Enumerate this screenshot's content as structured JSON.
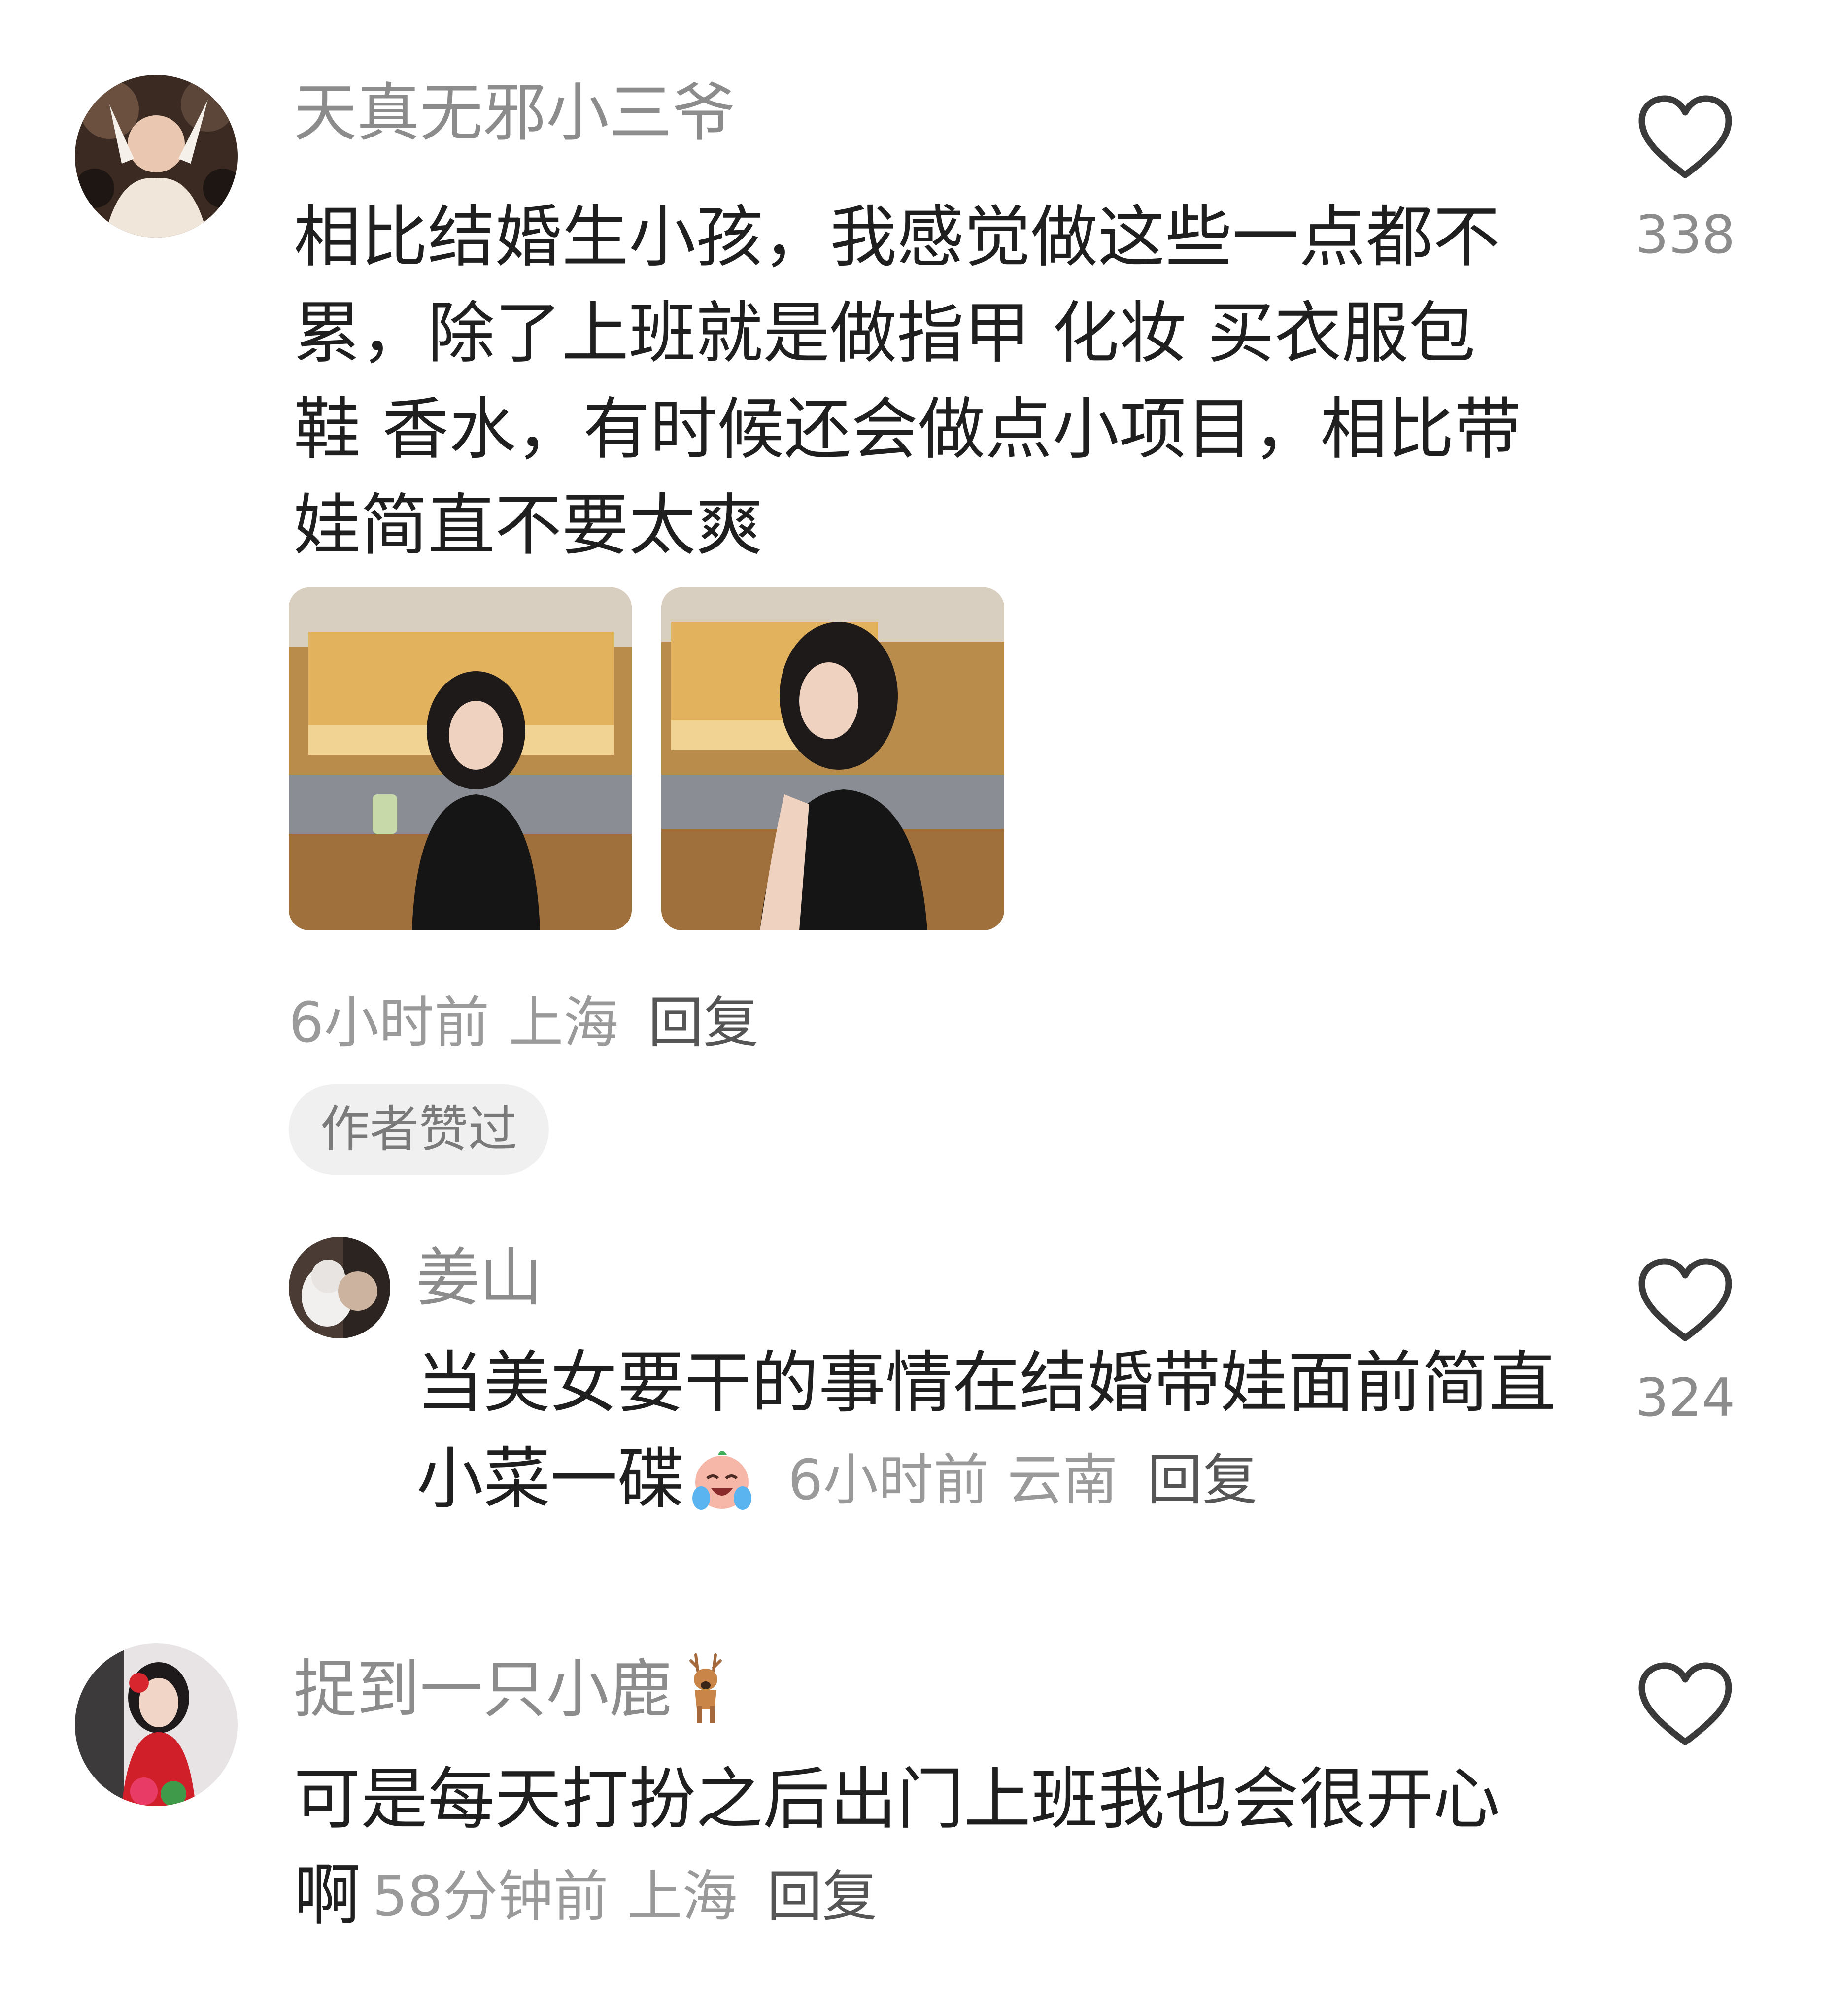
{
  "comments": [
    {
      "username": "天真无邪小三爷",
      "text": "相比结婚生小孩，我感觉做这些一点都不累，除了上班就是做指甲 化妆 买衣服包鞋 香水，有时候还会做点小项目，相比带娃简直不要太爽",
      "time": "6小时前",
      "location": "上海",
      "reply_label": "回复",
      "like_count": "338",
      "badge": "作者赞过",
      "reply": {
        "username": "姜山",
        "text": "当美女要干的事情在结婚带娃面前简直小菜一碟",
        "emoji": "laugh-crying-emoji",
        "time": "6小时前",
        "location": "云南",
        "reply_label": "回复",
        "like_count": "324"
      }
    },
    {
      "username": "捉到一只小鹿",
      "username_emoji": "deer-emoji",
      "text": "可是每天打扮之后出门上班我也会很开心啊",
      "time": "58分钟前",
      "location": "上海",
      "reply_label": "回复",
      "like_count": ""
    }
  ],
  "colors": {
    "username": "#8c8c8c",
    "body_text": "#1f1f1f",
    "meta_text": "#9a9a9a",
    "badge_bg": "#f0f0f0"
  }
}
